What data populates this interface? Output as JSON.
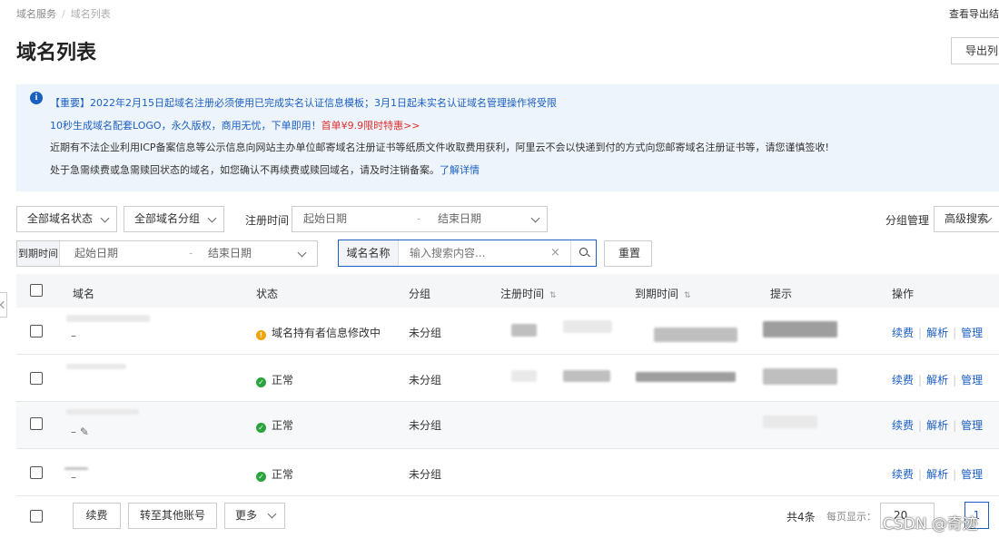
{
  "breadcrumb": {
    "root": "域名服务",
    "sep": "/",
    "current": "域名列表"
  },
  "top_link": "查看导出结",
  "page_title": "域名列表",
  "export_button": "导出列",
  "notice": {
    "line1": "【重要】2022年2月15日起域名注册必须使用已完成实名认证信息模板；3月1日起未实名认证域名管理操作将受限",
    "line2_main": "10秒生成域名配套LOGO，永久版权，商用无忧，下单即用！",
    "line2_hot": "首单¥9.9限时特惠>>",
    "line3": "近期有不法企业利用ICP备案信息等公示信息向网站主办单位邮寄域名注册证书等纸质文件收取费用获利，阿里云不会以快递到付的方式向您邮寄域名注册证书等，请您谨慎签收!",
    "line4_main": "处于急需续费或急需赎回状态的域名，如您确认不再续费或赎回域名，请及时注销备案。",
    "line4_link": "了解详情"
  },
  "filters": {
    "status_select": "全部域名状态",
    "group_select": "全部域名分组",
    "reg_time_label": "注册时间",
    "reg_start": "起始日期",
    "reg_end": "结束日期",
    "group_manage": "分组管理",
    "advanced_search": "高级搜索",
    "exp_time_label": "到期时间",
    "exp_start": "起始日期",
    "exp_end": "结束日期",
    "date_dash": "-",
    "search_tag": "域名名称",
    "search_placeholder": "输入搜索内容...",
    "reset": "重置"
  },
  "table": {
    "headers": {
      "domain": "域名",
      "status": "状态",
      "group": "分组",
      "reg_time": "注册时间",
      "exp_time": "到期时间",
      "hint": "提示",
      "ops": "操作"
    },
    "sort_glyph": "⇅",
    "rows": [
      {
        "domain_suffix": "–",
        "status": "域名持有者信息修改中",
        "status_type": "warning",
        "group": "未分组"
      },
      {
        "domain_suffix": "",
        "status": "正常",
        "status_type": "ok",
        "group": "未分组"
      },
      {
        "domain_suffix": "– ✎",
        "status": "正常",
        "status_type": "ok",
        "group": "未分组"
      },
      {
        "domain_suffix": "–",
        "status": "正常",
        "status_type": "ok",
        "group": "未分组"
      }
    ],
    "ops": {
      "renew": "续费",
      "resolve": "解析",
      "manage": "管理"
    }
  },
  "footer": {
    "renew": "续费",
    "transfer": "转至其他账号",
    "more": "更多",
    "total": "共4条",
    "per_page_label": "每页显示：",
    "per_page": "20",
    "page": "1"
  },
  "watermark": "CSDN @奇迹",
  "colors": {
    "link": "#1b5fc1",
    "hot": "#e0302d",
    "warning": "#f1a300",
    "ok": "#2aa43f",
    "notice_bg": "#eef4fb"
  }
}
